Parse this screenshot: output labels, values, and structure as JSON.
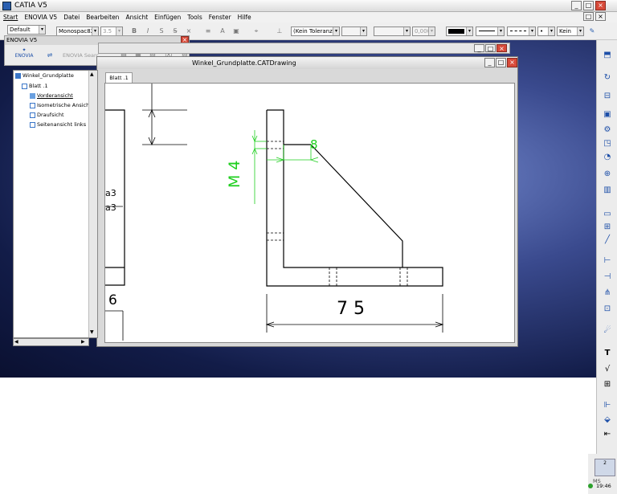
{
  "window": {
    "title": "CATIA V5"
  },
  "menu": [
    "Start",
    "ENOVIA V5",
    "Datei",
    "Bearbeiten",
    "Ansicht",
    "Einfügen",
    "Tools",
    "Fenster",
    "Hilfe"
  ],
  "toolbar": {
    "style_value": "Default",
    "font_value": "Monospac821",
    "size_value": "3.5",
    "tolerance_value": "(Kein Toleranzb",
    "precision_value": "0,000",
    "pattern_value": "Kein"
  },
  "enovia": {
    "title": "ENOVIA V5",
    "search_label": "ENOVIA Searc..."
  },
  "tree": {
    "root": "Winkel_Grundplatte",
    "sheet": "Blatt .1",
    "views": [
      "Vorderansicht",
      "Isometrische Ansicht",
      "Draufsicht",
      "Seitenansicht links"
    ]
  },
  "drawing": {
    "title": "Winkel_Grundplatte.CATDrawing",
    "tab": "Blatt .1",
    "dim_8": "8",
    "dim_m4": "M 4",
    "dim_75": "7 5",
    "left_a3_1": "a3",
    "left_a3_2": "a3",
    "left_6": "6"
  },
  "clock": {
    "time": "19:46",
    "status": "MS"
  },
  "colors": {
    "dimension_green": "#1fcf1f",
    "accent": "#2a5fb0"
  }
}
